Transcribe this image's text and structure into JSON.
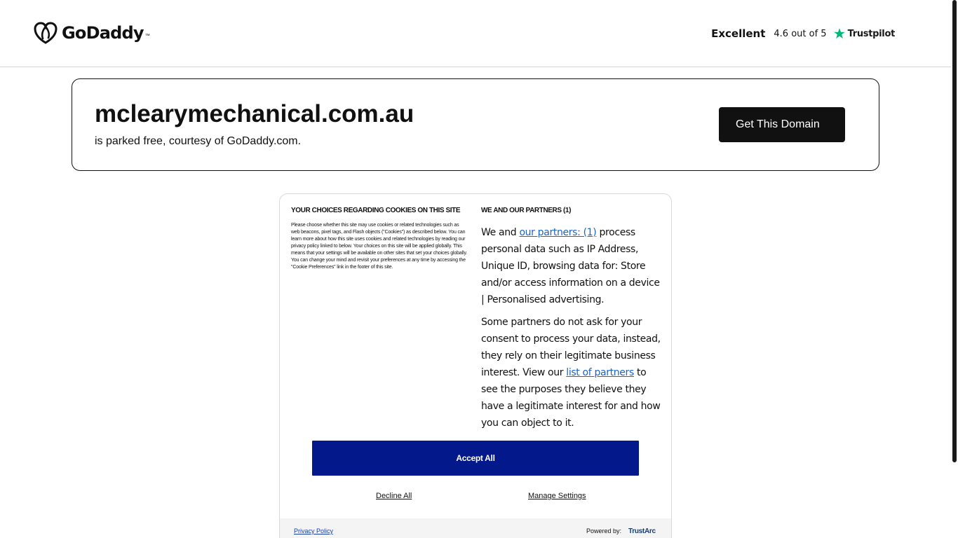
{
  "header": {
    "logo_text": "GoDaddy",
    "logo_tm": "™",
    "trustpilot": {
      "rating_word": "Excellent",
      "score_text": "4.6 out of 5",
      "brand": "Trustpilot",
      "star_color": "#00b67a"
    }
  },
  "domain_box": {
    "domain": "mclearymechanical.com.au",
    "subtitle": "is parked free, courtesy of GoDaddy.com.",
    "cta_label": "Get This Domain"
  },
  "cookie_dialog": {
    "left": {
      "title": "YOUR CHOICES REGARDING COOKIES ON THIS SITE",
      "body": "Please choose whether this site may use cookies or related technologies such as web beacons, pixel tags, and Flash objects (\"Cookies\") as described below. You can learn more about how this site uses cookies and related technologies by reading our privacy policy linked to below. Your choices on this site will be applied globally. This means that your settings will be available on other sites that set your choices globally. You can change your mind and revisit your preferences at any time by accessing the \"Cookie Preferences\" link in the footer of this site."
    },
    "right": {
      "title": "WE AND OUR PARTNERS (1)",
      "p1_before": "We and ",
      "p1_link": "our partners: (1)",
      "p1_after": " process personal data such as IP Address, Unique ID, browsing data for: Store and/or access information on a device | Personalised advertising.",
      "p2_before": "Some partners do not ask for your consent to process your data, instead, they rely on their legitimate business interest. View our ",
      "p2_link": "list of partners",
      "p2_after": " to see the purposes they believe they have a legitimate interest for and how you can object to it."
    },
    "accept_label": "Accept All",
    "decline_label": "Decline All",
    "manage_label": "Manage Settings",
    "footer": {
      "privacy_label": "Privacy Policy",
      "powered_label": "Powered by:",
      "trustarc_label": "TrustArc"
    },
    "accept_color": "#02188b",
    "link_color": "#1a63c9"
  }
}
